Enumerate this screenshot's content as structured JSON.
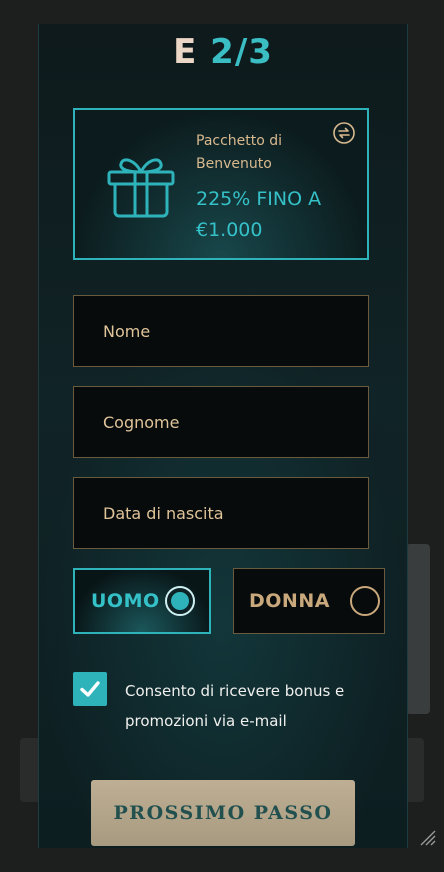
{
  "header": {
    "step_letter": "E",
    "step_count": "2/3"
  },
  "bonus": {
    "title": "Pacchetto di Benvenuto",
    "amount": "225% FINO A €1.000",
    "icon": "gift-icon",
    "swap_icon": "refresh-icon"
  },
  "form": {
    "first_name": {
      "placeholder": "Nome",
      "value": ""
    },
    "last_name": {
      "placeholder": "Cognome",
      "value": ""
    },
    "birth_date": {
      "placeholder": "Data di nascita",
      "value": ""
    }
  },
  "gender": {
    "male_label": "UOMO",
    "female_label": "DONNA",
    "selected": "UOMO"
  },
  "consent": {
    "checked": true,
    "text": "Consento di ricevere bonus e promozioni via e-mail"
  },
  "actions": {
    "next_label": "PROSSIMO PASSO"
  },
  "colors": {
    "accent": "#2fb3bb",
    "gold": "#d9b98e",
    "panel_bg": "#0e1a1c",
    "button_bg": "#beaf94"
  }
}
